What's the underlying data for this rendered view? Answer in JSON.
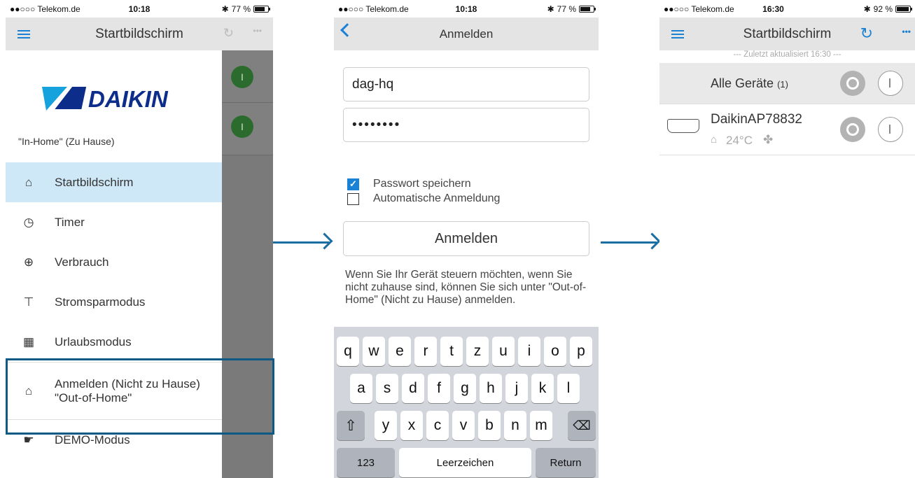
{
  "screen1": {
    "status": {
      "carrier": "●●○○○ Telekom.de",
      "time": "10:18",
      "battery": "77 %"
    },
    "nav_title": "Startbildschirm",
    "brand": "DAIKIN",
    "location": "\"In-Home\" (Zu Hause)",
    "menu": [
      {
        "label": "Startbildschirm",
        "icon": "home-icon"
      },
      {
        "label": "Timer",
        "icon": "clock-icon"
      },
      {
        "label": "Verbrauch",
        "icon": "plug-icon"
      },
      {
        "label": "Stromsparmodus",
        "icon": "power-save-icon"
      },
      {
        "label": "Urlaubsmodus",
        "icon": "suitcase-icon"
      },
      {
        "label": "Anmelden (Nicht zu Hause)",
        "label2": "\"Out-of-Home\"",
        "icon": "remote-home-icon"
      },
      {
        "label": "DEMO-Modus",
        "icon": "demo-icon"
      }
    ],
    "power_glyph": "I"
  },
  "screen2": {
    "status": {
      "carrier": "●●○○○ Telekom.de",
      "time": "10:18",
      "battery": "77 %"
    },
    "nav_title": "Anmelden",
    "username": "dag-hq",
    "password": "••••••••",
    "save_password": "Passwort speichern",
    "auto_login": "Automatische Anmeldung",
    "login_button": "Anmelden",
    "help": "Wenn Sie Ihr Gerät steuern möchten, wenn Sie nicht zuhause sind, können Sie sich unter \"Out-of-Home\" (Nicht zu Hause) anmelden.",
    "keyboard": {
      "row1": [
        "q",
        "w",
        "e",
        "r",
        "t",
        "z",
        "u",
        "i",
        "o",
        "p"
      ],
      "row2": [
        "a",
        "s",
        "d",
        "f",
        "g",
        "h",
        "j",
        "k",
        "l"
      ],
      "row3": [
        "y",
        "x",
        "c",
        "v",
        "b",
        "n",
        "m"
      ],
      "shift": "⇧",
      "backspace": "⌫",
      "numbers": "123",
      "space": "Leerzeichen",
      "return": "Return"
    }
  },
  "screen3": {
    "status": {
      "carrier": "●●○○○ Telekom.de",
      "time": "16:30",
      "battery": "92 %"
    },
    "nav_title": "Startbildschirm",
    "updated": "--- Zuletzt aktualisiert 16:30 ---",
    "all_devices": "Alle Geräte",
    "all_count": "(1)",
    "device_name": "DaikinAP78832",
    "device_temp": "24°C"
  },
  "colors": {
    "accent": "#1a82d6",
    "highlight_border": "#0e5a84",
    "arrow": "#1a6ea2",
    "active_item": "#cfe8f7"
  }
}
